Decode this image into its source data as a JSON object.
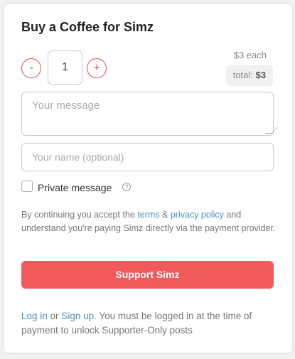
{
  "title": "Buy a Coffee for Simz",
  "quantity": {
    "minus_label": "-",
    "value": "1",
    "plus_label": "+"
  },
  "price": {
    "each": "$3 each",
    "total_label": "total:",
    "total_value": "$3"
  },
  "form": {
    "message_placeholder": "Your message",
    "name_placeholder": "Your name (optional)",
    "private_label": "Private message",
    "help_icon": "?"
  },
  "terms": {
    "prefix": "By continuing you accept the ",
    "terms_link": "terms",
    "amp": " & ",
    "privacy_link": "privacy policy",
    "suffix": " and understand you're paying Simz directly via the payment provider."
  },
  "support_button": "Support Simz",
  "login_note": {
    "login_link": "Log in",
    "or": " or ",
    "signup_link": "Sign up",
    "suffix": ". You must be logged in at the time of payment to unlock Supporter-Only posts"
  },
  "colors": {
    "accent": "#f05a5a",
    "link": "#4a90c2"
  }
}
